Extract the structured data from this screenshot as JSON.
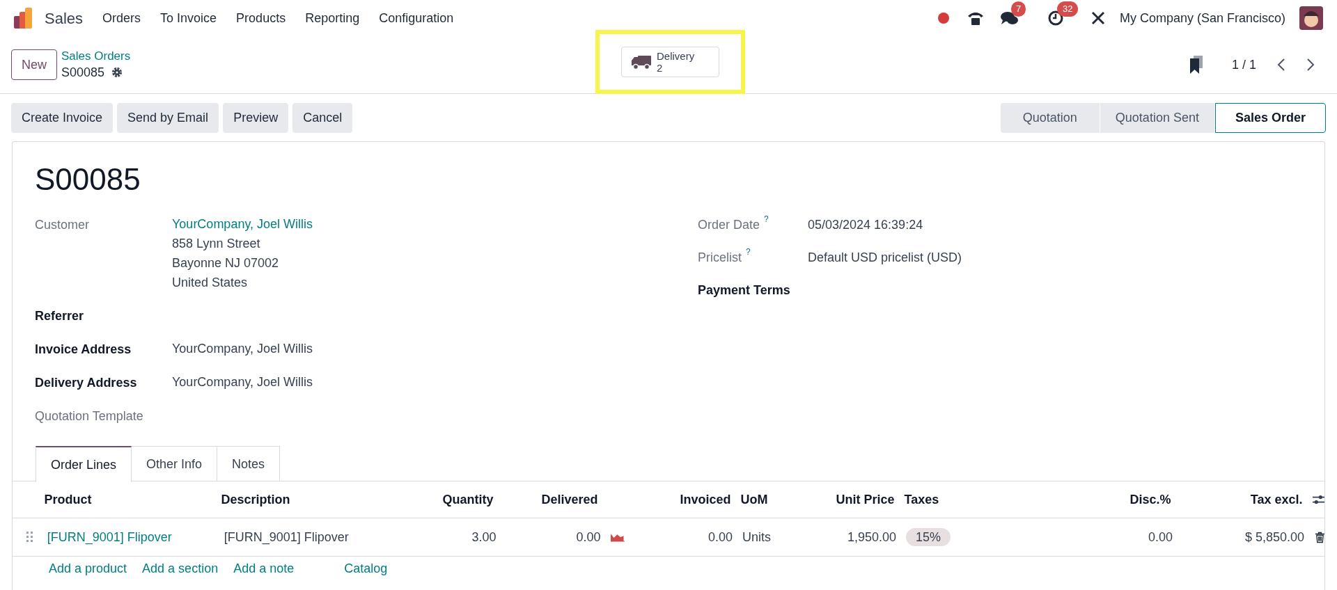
{
  "navbar": {
    "app_name": "Sales",
    "menus": [
      "Orders",
      "To Invoice",
      "Products",
      "Reporting",
      "Configuration"
    ],
    "messages_badge": "7",
    "activities_badge": "32",
    "company": "My Company (San Francisco)"
  },
  "control_panel": {
    "new_button": "New",
    "breadcrumb": "Sales Orders",
    "record": "S00085",
    "smart_button": {
      "label": "Delivery",
      "count": "2",
      "highlighted": true
    },
    "pager": "1 / 1"
  },
  "actions": [
    "Create Invoice",
    "Send by Email",
    "Preview",
    "Cancel"
  ],
  "statusbar": [
    {
      "label": "Quotation",
      "selected": false
    },
    {
      "label": "Quotation Sent",
      "selected": false
    },
    {
      "label": "Sales Order",
      "selected": true
    }
  ],
  "form": {
    "title": "S00085",
    "left_fields": [
      {
        "label": "Customer",
        "bold": false,
        "values": [
          {
            "text": "YourCompany, Joel Willis",
            "link": true
          },
          {
            "text": "858 Lynn Street",
            "link": false
          },
          {
            "text": "Bayonne NJ 07002",
            "link": false
          },
          {
            "text": "United States",
            "link": false
          }
        ]
      },
      {
        "label": "Referrer",
        "bold": true
      },
      {
        "label": "Invoice Address",
        "bold": true,
        "values": [
          {
            "text": "YourCompany, Joel Willis",
            "link": false
          }
        ]
      },
      {
        "label": "Delivery Address",
        "bold": true,
        "values": [
          {
            "text": "YourCompany, Joel Willis",
            "link": false
          }
        ]
      },
      {
        "label": "Quotation Template",
        "bold": false
      }
    ],
    "right_fields": [
      {
        "label": "Order Date",
        "help": "?",
        "bold": false,
        "value": "05/03/2024 16:39:24"
      },
      {
        "label": "Pricelist",
        "help": "?",
        "bold": false,
        "value": "Default USD pricelist (USD)"
      },
      {
        "label": "Payment Terms",
        "bold": true
      }
    ]
  },
  "tabs": [
    {
      "label": "Order Lines",
      "selected": true
    },
    {
      "label": "Other Info",
      "selected": false
    },
    {
      "label": "Notes",
      "selected": false
    }
  ],
  "table": {
    "columns": [
      "Product",
      "Description",
      "Quantity",
      "Delivered",
      "Invoiced",
      "UoM",
      "Unit Price",
      "Taxes",
      "Disc.%",
      "Tax excl."
    ],
    "rows": [
      {
        "product": "[FURN_9001] Flipover",
        "description": "[FURN_9001] Flipover",
        "quantity": "3.00",
        "delivered": "0.00",
        "invoiced": "0.00",
        "uom": "Units",
        "unit_price": "1,950.00",
        "taxes": "15%",
        "discount": "0.00",
        "subtotal": "$ 5,850.00"
      }
    ],
    "add_links": [
      "Add a product",
      "Add a section",
      "Add a note",
      "Catalog"
    ]
  }
}
